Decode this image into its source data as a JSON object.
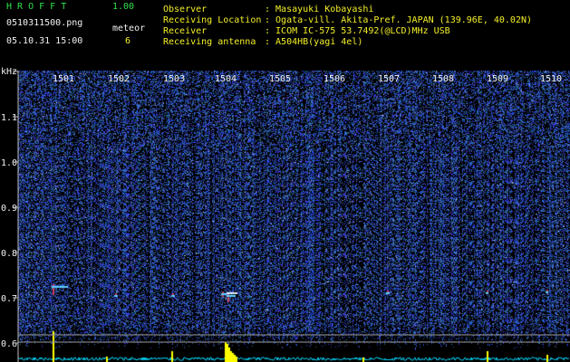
{
  "app": {
    "title": "H R O F F T",
    "version": "1.00",
    "filename": "0510311500.png",
    "date_time": "05.10.31 15:00",
    "mode_label": "meteor",
    "count": "6"
  },
  "info": [
    {
      "label": "Observer",
      "value": ": Masayuki Kobayashi"
    },
    {
      "label": "Receiving Location",
      "value": ": Ogata-vill. Akita-Pref. JAPAN (139.96E, 40.02N)"
    },
    {
      "label": "Receiver",
      "value": ": ICOM IC-575 53.7492(@LCD)MHz USB"
    },
    {
      "label": "Receiving antenna",
      "value": ": A504HB(yagi 4el)"
    }
  ],
  "waterfall": {
    "unit": "kHz",
    "time_labels": [
      "1501",
      "1502",
      "1503",
      "1504",
      "1505",
      "1506",
      "1507",
      "1508",
      "1509",
      "1510"
    ],
    "freq_labels": [
      "1.1",
      "1.0",
      "0.9",
      "0.8",
      "0.7",
      "0.6"
    ],
    "colors": {
      "background": "#000000",
      "noise": "#2a3cc8",
      "header_text": "#2fe04a",
      "axis_text": "#f2f2f2",
      "meteor_count": "#f4f028",
      "trace_line": "#00e0ff",
      "spike": "#ffff00"
    }
  }
}
